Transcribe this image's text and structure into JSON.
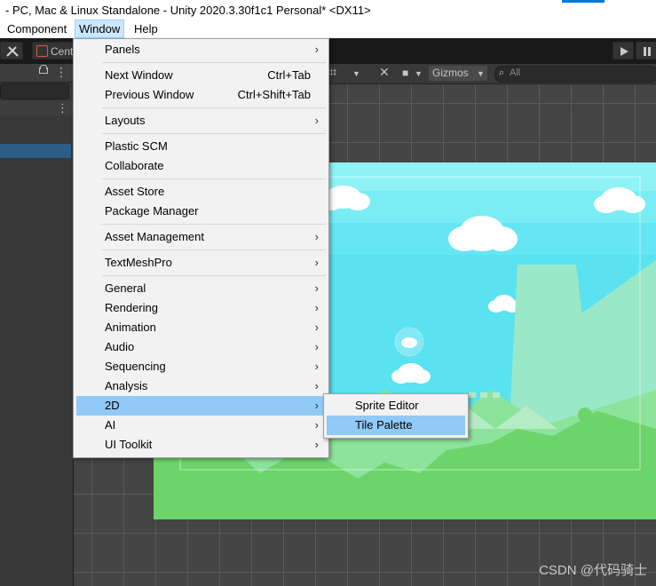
{
  "window": {
    "title": "- PC, Mac & Linux Standalone - Unity 2020.3.30f1c1 Personal* <DX11>"
  },
  "menubar": {
    "items": [
      {
        "label": "Component",
        "active": false
      },
      {
        "label": "Window",
        "active": true
      },
      {
        "label": "Help",
        "active": false
      }
    ]
  },
  "toolbar": {
    "center_label": "Cent",
    "play_icon": "play-icon",
    "pause_icon": "pause-icon"
  },
  "scene_toolbar": {
    "gizmos_label": "Gizmos",
    "search_placeholder": "All"
  },
  "window_menu": {
    "items": [
      {
        "label": "Panels",
        "shortcut": "",
        "submenu": true
      },
      {
        "label": "Next Window",
        "shortcut": "Ctrl+Tab",
        "submenu": false
      },
      {
        "label": "Previous Window",
        "shortcut": "Ctrl+Shift+Tab",
        "submenu": false
      },
      {
        "label": "Layouts",
        "shortcut": "",
        "submenu": true
      },
      {
        "label": "Plastic SCM",
        "shortcut": "",
        "submenu": false
      },
      {
        "label": "Collaborate",
        "shortcut": "",
        "submenu": false
      },
      {
        "label": "Asset Store",
        "shortcut": "",
        "submenu": false
      },
      {
        "label": "Package Manager",
        "shortcut": "",
        "submenu": false
      },
      {
        "label": "Asset Management",
        "shortcut": "",
        "submenu": true
      },
      {
        "label": "TextMeshPro",
        "shortcut": "",
        "submenu": true
      },
      {
        "label": "General",
        "shortcut": "",
        "submenu": true
      },
      {
        "label": "Rendering",
        "shortcut": "",
        "submenu": true
      },
      {
        "label": "Animation",
        "shortcut": "",
        "submenu": true
      },
      {
        "label": "Audio",
        "shortcut": "",
        "submenu": true
      },
      {
        "label": "Sequencing",
        "shortcut": "",
        "submenu": true
      },
      {
        "label": "Analysis",
        "shortcut": "",
        "submenu": true
      },
      {
        "label": "2D",
        "shortcut": "",
        "submenu": true,
        "highlighted": true
      },
      {
        "label": "AI",
        "shortcut": "",
        "submenu": true
      },
      {
        "label": "UI Toolkit",
        "shortcut": "",
        "submenu": true
      }
    ],
    "arrow_glyph": "›"
  },
  "submenu_2d": {
    "items": [
      {
        "label": "Sprite Editor",
        "highlighted": false
      },
      {
        "label": "Tile Palette",
        "highlighted": true
      }
    ]
  },
  "watermark": "CSDN @代码骑士",
  "colors": {
    "menu_highlight": "#91c9f7",
    "sky": "#5ae2f0",
    "grass": "#6cd46a"
  }
}
